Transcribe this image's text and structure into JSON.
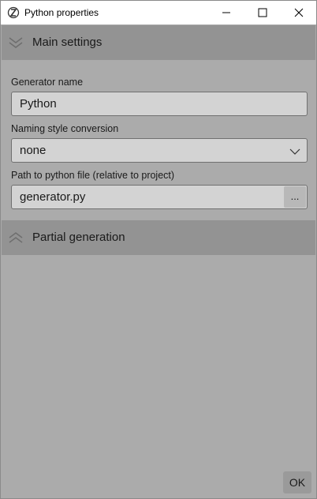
{
  "window": {
    "title": "Python properties",
    "minimize_icon": "minimize-icon",
    "maximize_icon": "maximize-icon",
    "close_icon": "close-icon"
  },
  "sections": {
    "main": {
      "label": "Main settings",
      "icon": "chevron-double-down-icon",
      "expanded": true
    },
    "partial": {
      "label": "Partial generation",
      "icon": "chevron-double-up-icon",
      "expanded": false
    }
  },
  "fields": {
    "generator_name": {
      "label": "Generator name",
      "value": "Python"
    },
    "naming_style": {
      "label": "Naming style conversion",
      "value": "none"
    },
    "python_path": {
      "label": "Path to python file (relative to project)",
      "value": "generator.py",
      "browse_label": "..."
    }
  },
  "footer": {
    "ok_label": "OK"
  },
  "colors": {
    "panel": "#ababab",
    "header": "#939393",
    "input_bg": "#d3d3d3"
  }
}
